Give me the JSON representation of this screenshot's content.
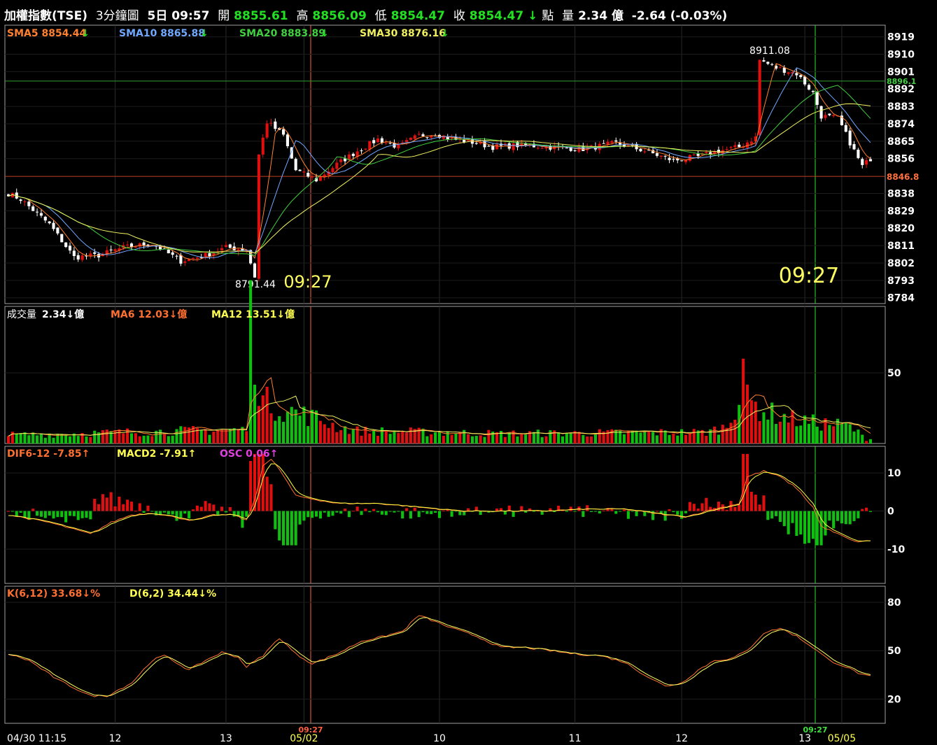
{
  "header": {
    "name": "加權指數(TSE)",
    "interval": "3分鐘圖",
    "days": "5日",
    "time": "09:57",
    "open_label": "開",
    "open": "8855.61",
    "high_label": "高",
    "high": "8856.09",
    "low_label": "低",
    "low": "8854.47",
    "close_label": "收",
    "close": "8854.47",
    "arrow": "↓",
    "point_label": "點",
    "volume_label": "量",
    "volume": "2.34 億",
    "change": "-2.64 (-0.03%)"
  },
  "colors": {
    "up": "#e01010",
    "down": "#ffffff",
    "vol_up": "#e01010",
    "vol_down": "#10c010",
    "sma5": "#ff8030",
    "sma10": "#70a8ff",
    "sma20": "#40d040",
    "sma30": "#f0f060",
    "dif": "#ff7030",
    "macd": "#ffff40",
    "osc": "#e040e0",
    "k": "#ff7030",
    "d": "#ffff60",
    "cursor_left": "#ff6040",
    "cursor_right": "#30e030"
  },
  "chart_data": [
    {
      "type": "candlestick",
      "title": "",
      "legend": [
        {
          "name": "SMA5",
          "value": "8854.44",
          "arrow": "↓"
        },
        {
          "name": "SMA10",
          "value": "8865.88",
          "arrow": "↓"
        },
        {
          "name": "SMA20",
          "value": "8883.89",
          "arrow": "↓"
        },
        {
          "name": "SMA30",
          "value": "8876.16",
          "arrow": "↓"
        }
      ],
      "y_ticks": [
        8919,
        8910,
        8901,
        8892,
        8883,
        8874,
        8865,
        8856,
        8838,
        8829,
        8820,
        8811,
        8802,
        8793,
        8784
      ],
      "ylim": [
        8781,
        8925
      ],
      "reference_lines": [
        {
          "label": "8896.1",
          "value": 8896.1
        },
        {
          "label": "8846.8",
          "value": 8846.8
        }
      ],
      "annotations": [
        {
          "text": "8911.08",
          "type": "high"
        },
        {
          "text": "8791.44",
          "type": "low"
        },
        {
          "text": "09:27",
          "type": "cursor-left"
        },
        {
          "text": "09:27",
          "type": "cursor-right"
        }
      ],
      "keypoints": [
        [
          0,
          8838
        ],
        [
          3,
          8835
        ],
        [
          10,
          8822
        ],
        [
          16,
          8805
        ],
        [
          22,
          8806
        ],
        [
          28,
          8810
        ],
        [
          35,
          8812
        ],
        [
          42,
          8803
        ],
        [
          48,
          8806
        ],
        [
          53,
          8810
        ],
        [
          58,
          8809
        ],
        [
          60,
          8795
        ],
        [
          61,
          8858
        ],
        [
          63,
          8875
        ],
        [
          67,
          8868
        ],
        [
          70,
          8850
        ],
        [
          75,
          8845
        ],
        [
          80,
          8853
        ],
        [
          85,
          8860
        ],
        [
          90,
          8866
        ],
        [
          95,
          8862
        ],
        [
          100,
          8868
        ],
        [
          104,
          8869
        ],
        [
          108,
          8866
        ],
        [
          112,
          8865
        ],
        [
          118,
          8862
        ],
        [
          125,
          8863
        ],
        [
          132,
          8862
        ],
        [
          140,
          8861
        ],
        [
          148,
          8864
        ],
        [
          155,
          8860
        ],
        [
          162,
          8855
        ],
        [
          168,
          8857
        ],
        [
          173,
          8860
        ],
        [
          178,
          8862
        ],
        [
          182,
          8867
        ],
        [
          183,
          8907
        ],
        [
          187,
          8903
        ],
        [
          192,
          8900
        ],
        [
          196,
          8890
        ],
        [
          198,
          8878
        ],
        [
          202,
          8877
        ],
        [
          206,
          8860
        ],
        [
          208,
          8852
        ],
        [
          210,
          8856
        ]
      ]
    },
    {
      "type": "bar",
      "legend": [
        {
          "name": "成交量",
          "value": "2.34",
          "arrow": "↓",
          "unit": "億"
        },
        {
          "name": "MA6",
          "value": "12.03",
          "arrow": "↓",
          "unit": "億"
        },
        {
          "name": "MA12",
          "value": "13.51",
          "arrow": "↓",
          "unit": "億"
        }
      ],
      "y_ticks": [
        50
      ],
      "ylim": [
        0,
        95
      ],
      "keypoints": [
        [
          0,
          6
        ],
        [
          58,
          10
        ],
        [
          59,
          90
        ],
        [
          60,
          68
        ],
        [
          61,
          42
        ],
        [
          62,
          30
        ],
        [
          64,
          28
        ],
        [
          66,
          25
        ],
        [
          70,
          22
        ],
        [
          75,
          18
        ],
        [
          80,
          12
        ],
        [
          85,
          9
        ],
        [
          120,
          7
        ],
        [
          170,
          8
        ],
        [
          175,
          12
        ],
        [
          178,
          35
        ],
        [
          179,
          62
        ],
        [
          180,
          30
        ],
        [
          185,
          22
        ],
        [
          190,
          18
        ],
        [
          195,
          15
        ],
        [
          200,
          14
        ],
        [
          205,
          12
        ],
        [
          209,
          3
        ]
      ]
    },
    {
      "type": "bar",
      "legend": [
        {
          "name": "DIF6-12",
          "value": "-7.85",
          "arrow": "↑"
        },
        {
          "name": "MACD2",
          "value": "-7.91",
          "arrow": "↑"
        },
        {
          "name": "OSC",
          "value": "0.06",
          "arrow": "↑"
        }
      ],
      "y_ticks": [
        10,
        0,
        -10
      ],
      "ylim": [
        -19,
        17
      ],
      "keypoints": [
        [
          0,
          -1
        ],
        [
          10,
          -3
        ],
        [
          20,
          -6
        ],
        [
          25,
          -3
        ],
        [
          30,
          -1
        ],
        [
          35,
          -0.5
        ],
        [
          40,
          -1.5
        ],
        [
          45,
          -2.5
        ],
        [
          50,
          -1
        ],
        [
          55,
          -1
        ],
        [
          58,
          -2.5
        ],
        [
          60,
          3
        ],
        [
          62,
          12
        ],
        [
          64,
          13.5
        ],
        [
          66,
          11
        ],
        [
          70,
          4
        ],
        [
          75,
          3
        ],
        [
          80,
          2
        ],
        [
          90,
          2
        ],
        [
          100,
          1
        ],
        [
          110,
          0
        ],
        [
          120,
          0
        ],
        [
          130,
          0
        ],
        [
          140,
          0.5
        ],
        [
          150,
          0.5
        ],
        [
          160,
          -1
        ],
        [
          165,
          -1.5
        ],
        [
          170,
          0
        ],
        [
          178,
          2
        ],
        [
          180,
          9
        ],
        [
          184,
          10.5
        ],
        [
          188,
          9
        ],
        [
          192,
          6
        ],
        [
          196,
          1
        ],
        [
          198,
          -4
        ],
        [
          202,
          -6
        ],
        [
          206,
          -8
        ],
        [
          209,
          -7.9
        ]
      ]
    },
    {
      "type": "line",
      "legend": [
        {
          "name": "K(6,12)",
          "value": "33.68",
          "arrow": "↓",
          "unit": "%"
        },
        {
          "name": "D(6,2)",
          "value": "34.44",
          "arrow": "↓",
          "unit": "%"
        }
      ],
      "y_ticks": [
        80,
        50,
        20
      ],
      "ylim": [
        5,
        90
      ],
      "keypoints": [
        [
          0,
          48
        ],
        [
          5,
          44
        ],
        [
          12,
          32
        ],
        [
          20,
          22
        ],
        [
          24,
          22
        ],
        [
          30,
          30
        ],
        [
          35,
          44
        ],
        [
          38,
          47
        ],
        [
          44,
          38
        ],
        [
          48,
          44
        ],
        [
          52,
          49
        ],
        [
          56,
          46
        ],
        [
          58,
          40
        ],
        [
          62,
          47
        ],
        [
          66,
          58
        ],
        [
          70,
          48
        ],
        [
          74,
          42
        ],
        [
          80,
          48
        ],
        [
          86,
          56
        ],
        [
          90,
          58
        ],
        [
          96,
          62
        ],
        [
          100,
          72
        ],
        [
          104,
          68
        ],
        [
          108,
          64
        ],
        [
          114,
          59
        ],
        [
          120,
          52
        ],
        [
          126,
          52
        ],
        [
          132,
          50
        ],
        [
          138,
          48
        ],
        [
          144,
          47
        ],
        [
          150,
          43
        ],
        [
          155,
          35
        ],
        [
          160,
          28
        ],
        [
          164,
          30
        ],
        [
          168,
          38
        ],
        [
          172,
          44
        ],
        [
          176,
          45
        ],
        [
          180,
          50
        ],
        [
          184,
          61
        ],
        [
          188,
          64
        ],
        [
          192,
          59
        ],
        [
          196,
          52
        ],
        [
          200,
          44
        ],
        [
          204,
          40
        ],
        [
          208,
          35
        ],
        [
          210,
          34
        ]
      ]
    }
  ],
  "x_axis": {
    "labels": [
      "04/30 11:15",
      "12",
      "13",
      "05/02",
      "10",
      "11",
      "12",
      "13",
      "05/05"
    ],
    "cursor_labels": [
      "09:27",
      "09:27"
    ]
  }
}
